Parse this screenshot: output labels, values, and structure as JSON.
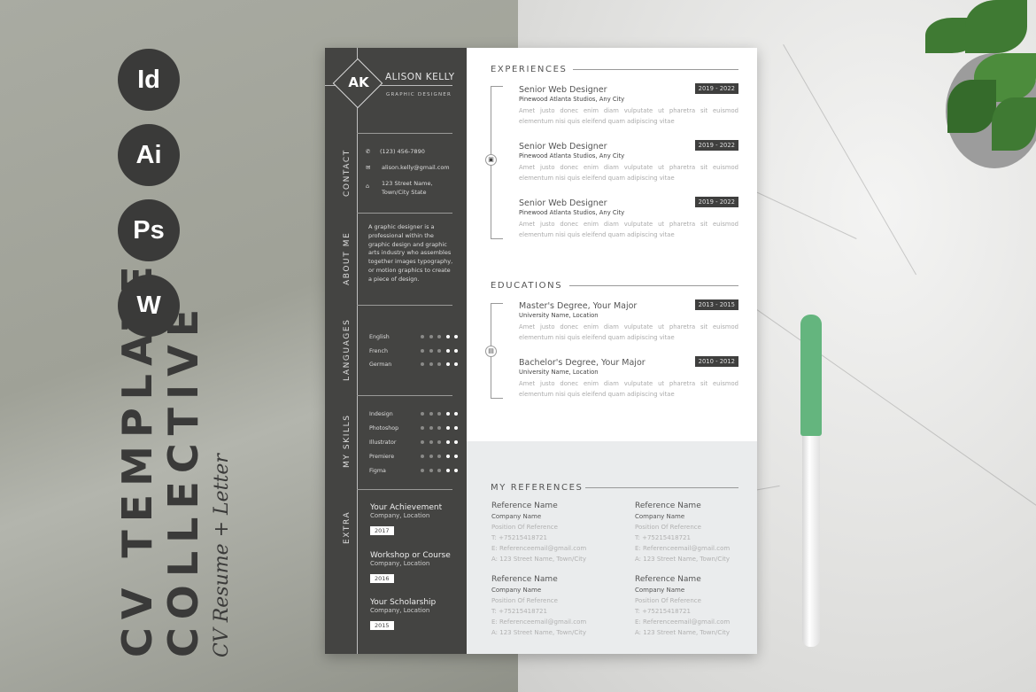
{
  "promo": {
    "app_icons": [
      "Id",
      "Ai",
      "Ps",
      "W"
    ],
    "title_line1": "CV TEMPLATE",
    "title_line2": "COLLECTIVE",
    "subtitle": "CV Resume + Letter"
  },
  "sidebar": {
    "initials": "AK",
    "name": "ALISON KELLY",
    "role": "GRAPHIC DESIGNER",
    "sections": {
      "contact": "CONTACT",
      "about": "ABOUT ME",
      "languages": "LANGUAGES",
      "skills": "MY SKILLS",
      "extra": "EXTRA"
    },
    "contact": {
      "phone": "(123) 456-7890",
      "email": "alison.kelly@gmail.com",
      "address_line1": "123 Street Name,",
      "address_line2": "Town/City State"
    },
    "about": "A graphic designer is a professional within the graphic design and graphic arts industry who assembles together images typography, or motion graphics to create a piece of design.",
    "languages": [
      {
        "name": "English",
        "filled": 2,
        "total": 5
      },
      {
        "name": "French",
        "filled": 2,
        "total": 5
      },
      {
        "name": "German",
        "filled": 2,
        "total": 5
      }
    ],
    "skills": [
      {
        "name": "Indesign",
        "filled": 2,
        "total": 5
      },
      {
        "name": "Photoshop",
        "filled": 2,
        "total": 5
      },
      {
        "name": "Illustrator",
        "filled": 2,
        "total": 5
      },
      {
        "name": "Premiere",
        "filled": 2,
        "total": 5
      },
      {
        "name": "Figma",
        "filled": 2,
        "total": 5
      }
    ],
    "extra": [
      {
        "title": "Your Achievement",
        "company": "Company, Location",
        "year": "2017"
      },
      {
        "title": "Workshop or Course",
        "company": "Company, Location",
        "year": "2016"
      },
      {
        "title": "Your Scholarship",
        "company": "Company, Location",
        "year": "2015"
      }
    ]
  },
  "experiences": {
    "heading": "EXPERIENCES",
    "items": [
      {
        "title": "Senior Web Designer",
        "company": "Pinewood Atlanta Studios, Any City",
        "dates": "2019 - 2022",
        "desc": "Amet justo donec enim diam vulputate ut pharetra sit euismod elementum nisi quis eleifend quam adipiscing vitae"
      },
      {
        "title": "Senior Web Designer",
        "company": "Pinewood Atlanta Studios, Any City",
        "dates": "2019 - 2022",
        "desc": "Amet justo donec enim diam vulputate ut pharetra sit euismod elementum nisi quis eleifend quam adipiscing vitae"
      },
      {
        "title": "Senior Web Designer",
        "company": "Pinewood Atlanta Studios, Any City",
        "dates": "2019 - 2022",
        "desc": "Amet justo donec enim diam vulputate ut pharetra sit euismod elementum nisi quis eleifend quam adipiscing vitae"
      }
    ]
  },
  "educations": {
    "heading": "EDUCATIONS",
    "items": [
      {
        "title": "Master's Degree, Your Major",
        "company": "University Name, Location",
        "dates": "2013 - 2015",
        "desc": "Amet justo donec enim diam vulputate ut pharetra sit euismod elementum nisi quis eleifend quam adipiscing vitae"
      },
      {
        "title": "Bachelor's Degree, Your Major",
        "company": "University Name, Location",
        "dates": "2010 - 2012",
        "desc": "Amet justo donec enim diam vulputate ut pharetra sit euismod elementum nisi quis eleifend quam adipiscing vitae"
      }
    ]
  },
  "references": {
    "heading": "MY REFERENCES",
    "items": [
      {
        "name": "Reference Name",
        "company": "Company Name",
        "position": "Position Of Reference",
        "phone": "T: +75215418721",
        "email": "E: Referenceemail@gmail.com",
        "address": "A: 123 Street Name, Town/City"
      },
      {
        "name": "Reference Name",
        "company": "Company Name",
        "position": "Position Of Reference",
        "phone": "T: +75215418721",
        "email": "E: Referenceemail@gmail.com",
        "address": "A: 123 Street Name, Town/City"
      },
      {
        "name": "Reference Name",
        "company": "Company Name",
        "position": "Position Of Reference",
        "phone": "T: +75215418721",
        "email": "E: Referenceemail@gmail.com",
        "address": "A: 123 Street Name, Town/City"
      },
      {
        "name": "Reference Name",
        "company": "Company Name",
        "position": "Position Of Reference",
        "phone": "T: +75215418721",
        "email": "E: Referenceemail@gmail.com",
        "address": "A: 123 Street Name, Town/City"
      }
    ]
  },
  "colors": {
    "sidebar": "#444442",
    "accent_pen": "#64b57e",
    "promo_bg": "#a3a59c"
  }
}
